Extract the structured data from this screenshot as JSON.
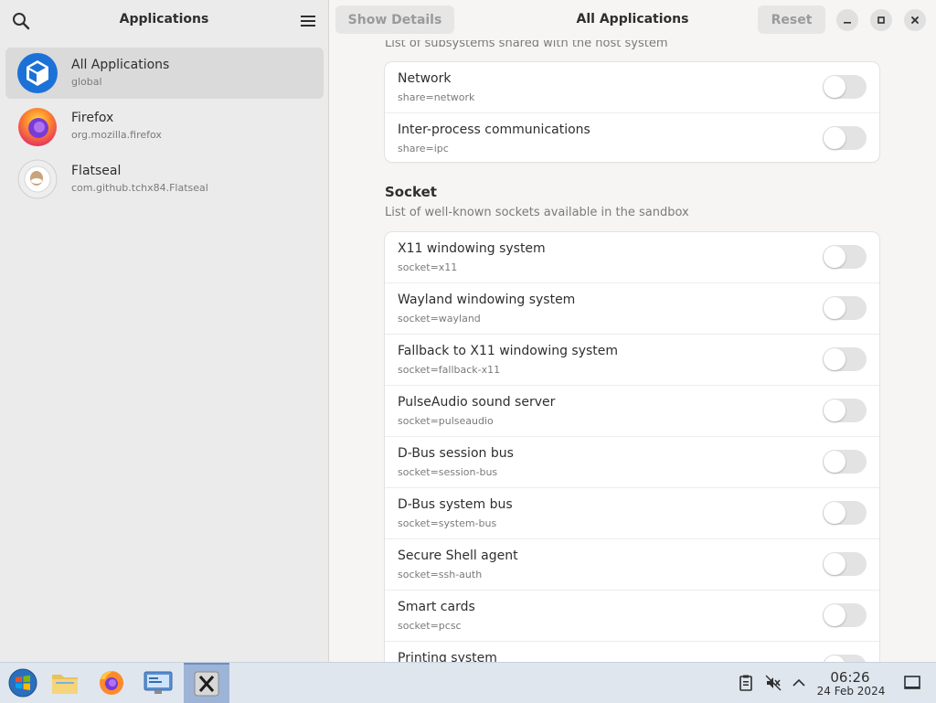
{
  "sidebar": {
    "title": "Applications",
    "apps": [
      {
        "name": "All Applications",
        "id": "global",
        "selected": true
      },
      {
        "name": "Firefox",
        "id": "org.mozilla.firefox",
        "selected": false
      },
      {
        "name": "Flatseal",
        "id": "com.github.tchx84.Flatseal",
        "selected": false
      }
    ]
  },
  "header": {
    "show_details_label": "Show Details",
    "title": "All Applications",
    "reset_label": "Reset"
  },
  "share_section": {
    "subtitle": "List of subsystems shared with the host system",
    "rows": [
      {
        "title": "Network",
        "key": "share=network",
        "enabled": false
      },
      {
        "title": "Inter-process communications",
        "key": "share=ipc",
        "enabled": false
      }
    ]
  },
  "socket_section": {
    "title": "Socket",
    "subtitle": "List of well-known sockets available in the sandbox",
    "rows": [
      {
        "title": "X11 windowing system",
        "key": "socket=x11",
        "enabled": false
      },
      {
        "title": "Wayland windowing system",
        "key": "socket=wayland",
        "enabled": false
      },
      {
        "title": "Fallback to X11 windowing system",
        "key": "socket=fallback-x11",
        "enabled": false
      },
      {
        "title": "PulseAudio sound server",
        "key": "socket=pulseaudio",
        "enabled": false
      },
      {
        "title": "D-Bus session bus",
        "key": "socket=session-bus",
        "enabled": false
      },
      {
        "title": "D-Bus system bus",
        "key": "socket=system-bus",
        "enabled": false
      },
      {
        "title": "Secure Shell agent",
        "key": "socket=ssh-auth",
        "enabled": false
      },
      {
        "title": "Smart cards",
        "key": "socket=pcsc",
        "enabled": false
      },
      {
        "title": "Printing system",
        "key": "",
        "enabled": false
      }
    ]
  },
  "taskbar": {
    "time": "06:26",
    "date": "24 Feb 2024",
    "items": [
      "start-menu-icon",
      "file-manager-icon",
      "firefox-icon",
      "control-panel-icon",
      "xfce-terminal-icon"
    ],
    "tray": [
      "clipboard-icon",
      "volume-muted-icon",
      "chevron-up-icon",
      "show-desktop-icon"
    ]
  },
  "colors": {
    "accent": "#1c71d8",
    "toggle_off": "#e3e3e3",
    "selected_bg": "#dadada"
  }
}
